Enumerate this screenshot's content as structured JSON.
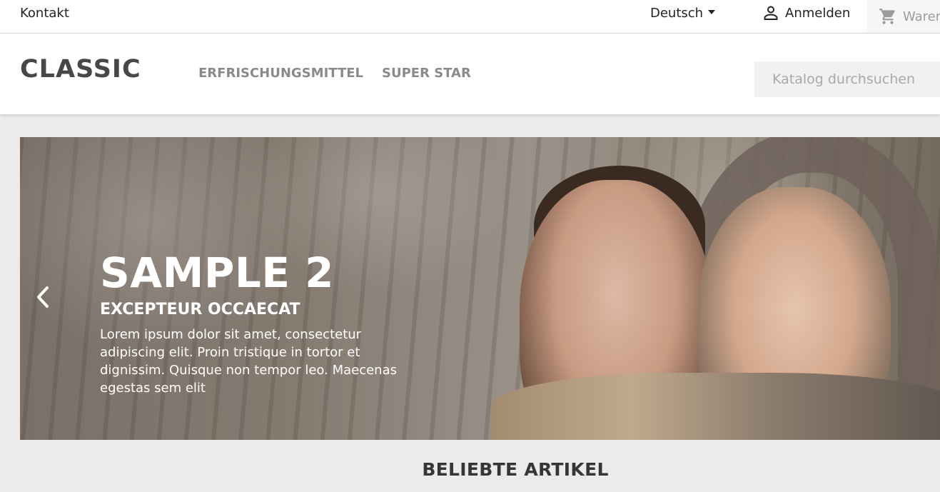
{
  "topbar": {
    "contact": "Kontakt",
    "language": "Deutsch",
    "signin": "Anmelden",
    "cart": "Waren"
  },
  "header": {
    "logo": "CLASSIC",
    "nav": [
      "ERFRISCHUNGSMITTEL",
      "SUPER STAR"
    ],
    "search_placeholder": "Katalog durchsuchen"
  },
  "slider": {
    "title": "SAMPLE 2",
    "subtitle": "EXCEPTEUR OCCAECAT",
    "text": "Lorem ipsum dolor sit amet, consectetur adipiscing elit. Proin tristique in tortor et dignissim. Quisque non tempor leo. Maecenas egestas sem elit"
  },
  "section": {
    "title": "BELIEBTE ARTIKEL"
  },
  "icons": {
    "user": "user-icon",
    "cart": "cart-icon",
    "prev": "chevron-left-icon",
    "dropdown": "caret-down-icon"
  },
  "colors": {
    "header_bg": "#ffffff",
    "page_bg": "#ebebeb",
    "nav_text": "#8a8a8a"
  }
}
